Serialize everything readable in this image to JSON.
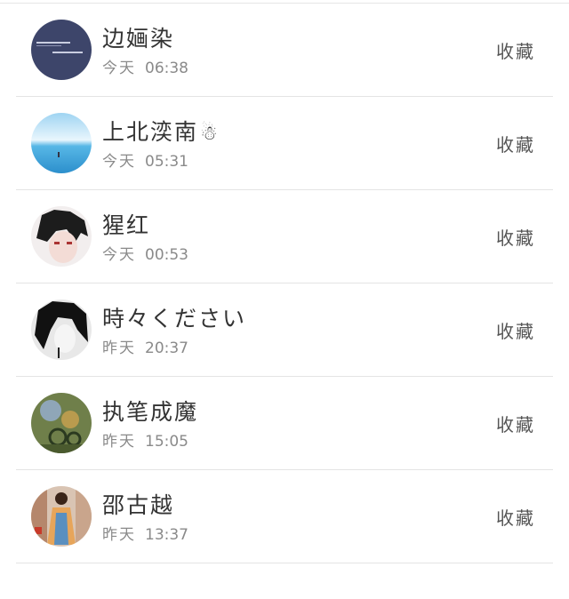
{
  "items": [
    {
      "name": "边婳染",
      "emoji": "",
      "day": "今天",
      "time": "06:38",
      "action": "收藏",
      "avatar": "avatar-dark-blue-text-icon"
    },
    {
      "name": "上北湙南",
      "emoji": "☃",
      "day": "今天",
      "time": "05:31",
      "action": "收藏",
      "avatar": "avatar-sky-sea-icon"
    },
    {
      "name": "猩红",
      "emoji": "",
      "day": "今天",
      "time": "00:53",
      "action": "收藏",
      "avatar": "avatar-anime-boy-icon"
    },
    {
      "name": "時々ください",
      "emoji": "",
      "day": "昨天",
      "time": "20:37",
      "action": "收藏",
      "avatar": "avatar-bw-portrait-icon"
    },
    {
      "name": "执笔成魔",
      "emoji": "",
      "day": "昨天",
      "time": "15:05",
      "action": "收藏",
      "avatar": "avatar-green-art-icon"
    },
    {
      "name": "邵古越",
      "emoji": "",
      "day": "昨天",
      "time": "13:37",
      "action": "收藏",
      "avatar": "avatar-costume-figure-icon"
    }
  ]
}
